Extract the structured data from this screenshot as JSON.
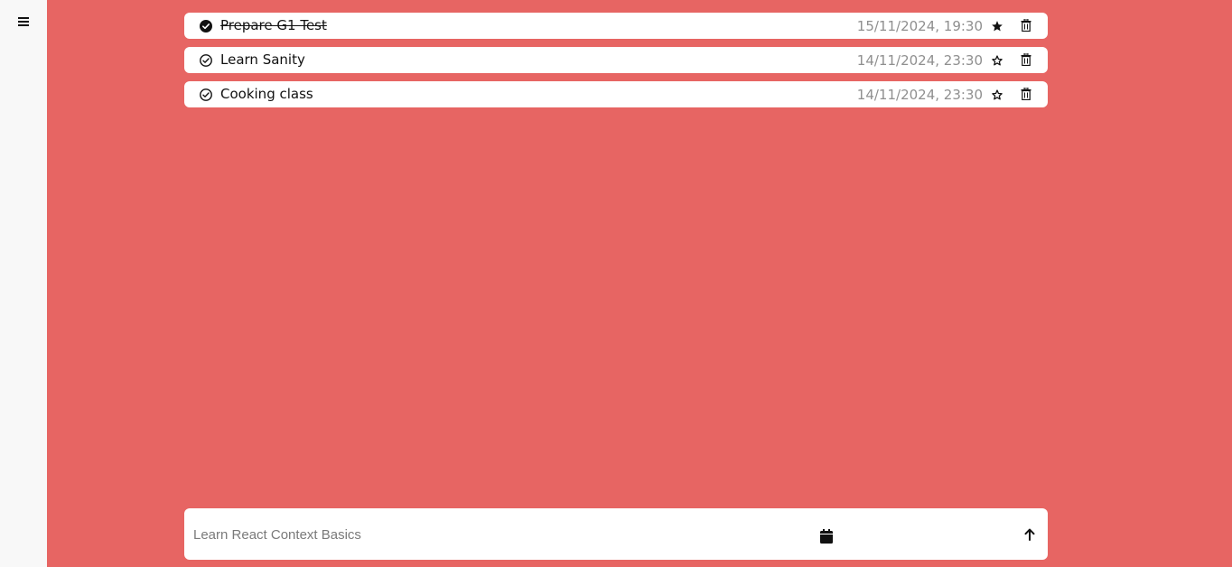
{
  "sidebar": {
    "menu_icon": "hamburger-menu-icon"
  },
  "tasks": [
    {
      "title": "Prepare G1 Test",
      "completed": true,
      "date": "15/11/2024, 19:30",
      "starred": true
    },
    {
      "title": "Learn Sanity",
      "completed": false,
      "date": "14/11/2024, 23:30",
      "starred": false
    },
    {
      "title": "Cooking class",
      "completed": false,
      "date": "14/11/2024, 23:30",
      "starred": false
    }
  ],
  "composer": {
    "placeholder": "Learn React Context Basics",
    "calendar_icon": "calendar-icon",
    "send_icon": "arrow-up-icon"
  },
  "colors": {
    "background": "#e76563",
    "sidebar": "#f8f8f8",
    "card": "#ffffff",
    "date_text": "#8f8f8f"
  }
}
